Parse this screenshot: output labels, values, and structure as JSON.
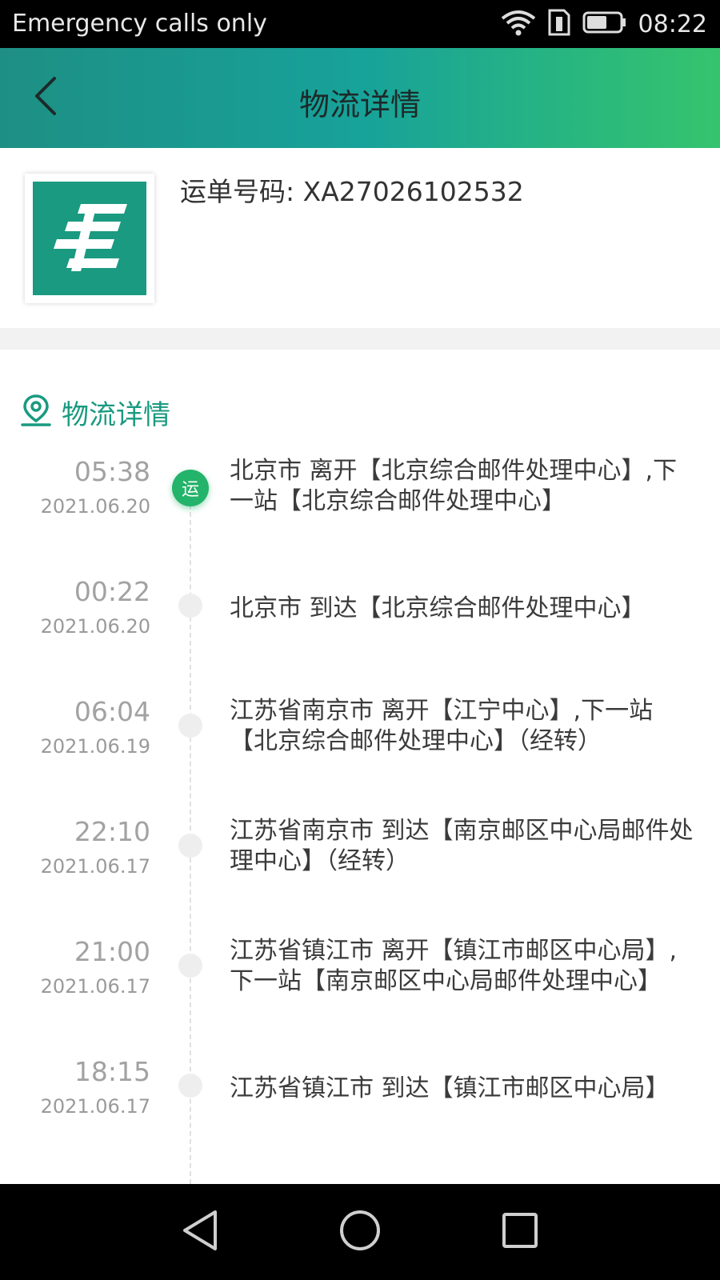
{
  "status_bar": {
    "carrier": "Emergency calls only",
    "time": "08:22",
    "icons": [
      "wifi-icon",
      "sim-icon",
      "battery-icon"
    ]
  },
  "header": {
    "title": "物流详情",
    "back_icon": "chevron-left-icon"
  },
  "waybill": {
    "label": "运单号码:  XA27026102532",
    "logo": "china-post-logo"
  },
  "section": {
    "title": "物流详情",
    "icon": "location-pin-icon"
  },
  "timeline": {
    "active_badge": "运",
    "events": [
      {
        "time": "05:38",
        "date": "2021.06.20",
        "desc": "北京市 离开【北京综合邮件处理中心】,下一站【北京综合邮件处理中心】"
      },
      {
        "time": "00:22",
        "date": "2021.06.20",
        "desc": "北京市 到达【北京综合邮件处理中心】"
      },
      {
        "time": "06:04",
        "date": "2021.06.19",
        "desc": "江苏省南京市 离开【江宁中心】,下一站【北京综合邮件处理中心】（经转）"
      },
      {
        "time": "22:10",
        "date": "2021.06.17",
        "desc": "江苏省南京市 到达【南京邮区中心局邮件处理中心】（经转）"
      },
      {
        "time": "21:00",
        "date": "2021.06.17",
        "desc": "江苏省镇江市 离开【镇江市邮区中心局】,下一站【南京邮区中心局邮件处理中心】"
      },
      {
        "time": "18:15",
        "date": "2021.06.17",
        "desc": "江苏省镇江市 到达【镇江市邮区中心局】"
      }
    ]
  },
  "colors": {
    "accent": "#1a9a80",
    "header_gradient_start": "#1e8f84",
    "header_gradient_end": "#35c46d",
    "active_dot": "#24b36a"
  },
  "nav": {
    "icons": [
      "back-triangle-icon",
      "home-circle-icon",
      "recents-square-icon"
    ]
  }
}
